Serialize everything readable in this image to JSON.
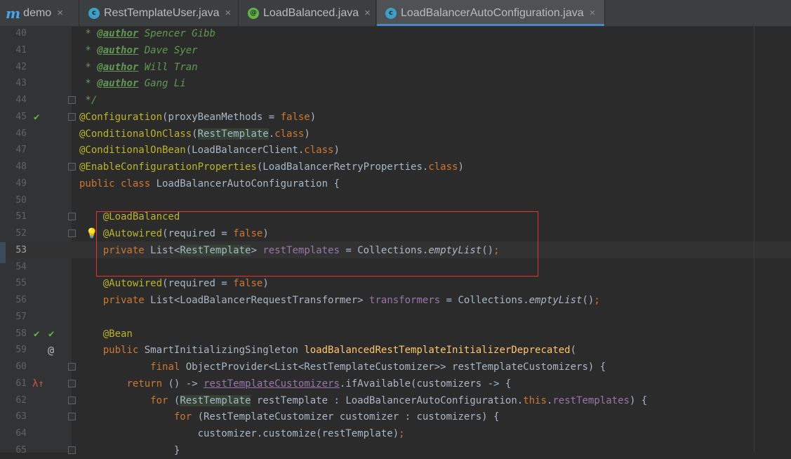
{
  "tabs": [
    {
      "label": "demo",
      "icon": "maven-module-icon",
      "active": false
    },
    {
      "label": "RestTemplateUser.java",
      "icon": "class-icon",
      "active": false
    },
    {
      "label": "LoadBalanced.java",
      "icon": "annotation-icon",
      "active": false
    },
    {
      "label": "LoadBalancerAutoConfiguration.java",
      "icon": "class-icon",
      "active": true
    }
  ],
  "tab_close_glyph": "×",
  "colors": {
    "keyword": "#cc7832",
    "annotation": "#bbb529",
    "field": "#9876aa",
    "comment": "#629755",
    "highlight_box": "#e0362b",
    "tab_underline": "#4a88c7"
  },
  "editor": {
    "caret_line": 53,
    "lines": [
      {
        "n": "40",
        "text": " * @author Spencer Gibb"
      },
      {
        "n": "41",
        "text": " * @author Dave Syer"
      },
      {
        "n": "42",
        "text": " * @author Will Tran"
      },
      {
        "n": "43",
        "text": " * @author Gang Li"
      },
      {
        "n": "44",
        "text": " */"
      },
      {
        "n": "45",
        "text": "@Configuration(proxyBeanMethods = false)"
      },
      {
        "n": "46",
        "text": "@ConditionalOnClass(RestTemplate.class)"
      },
      {
        "n": "47",
        "text": "@ConditionalOnBean(LoadBalancerClient.class)"
      },
      {
        "n": "48",
        "text": "@EnableConfigurationProperties(LoadBalancerRetryProperties.class)"
      },
      {
        "n": "49",
        "text": "public class LoadBalancerAutoConfiguration {"
      },
      {
        "n": "50",
        "text": ""
      },
      {
        "n": "51",
        "text": "    @LoadBalanced"
      },
      {
        "n": "52",
        "text": "    @Autowired(required = false)"
      },
      {
        "n": "53",
        "text": "    private List<RestTemplate> restTemplates = Collections.emptyList();"
      },
      {
        "n": "54",
        "text": ""
      },
      {
        "n": "55",
        "text": "    @Autowired(required = false)"
      },
      {
        "n": "56",
        "text": "    private List<LoadBalancerRequestTransformer> transformers = Collections.emptyList();"
      },
      {
        "n": "57",
        "text": ""
      },
      {
        "n": "58",
        "text": "    @Bean"
      },
      {
        "n": "59",
        "text": "    public SmartInitializingSingleton loadBalancedRestTemplateInitializerDeprecated("
      },
      {
        "n": "60",
        "text": "            final ObjectProvider<List<RestTemplateCustomizer>> restTemplateCustomizers) {"
      },
      {
        "n": "61",
        "text": "        return () -> restTemplateCustomizers.ifAvailable(customizers -> {"
      },
      {
        "n": "62",
        "text": "            for (RestTemplate restTemplate : LoadBalancerAutoConfiguration.this.restTemplates) {"
      },
      {
        "n": "63",
        "text": "                for (RestTemplateCustomizer customizer : customizers) {"
      },
      {
        "n": "64",
        "text": "                    customizer.customize(restTemplate);"
      },
      {
        "n": "65",
        "text": "                }"
      }
    ]
  }
}
